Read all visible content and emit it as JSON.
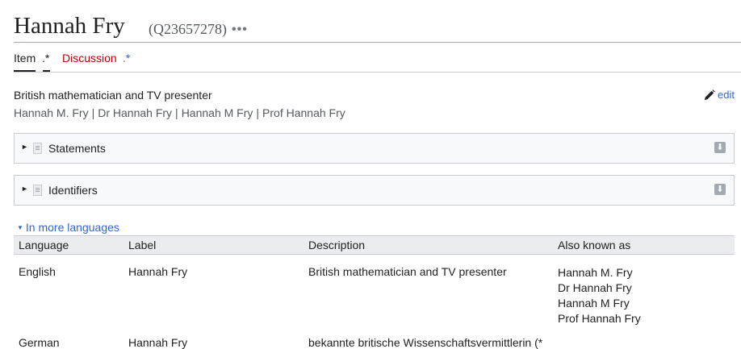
{
  "header": {
    "title": "Hannah Fry",
    "qid": "(Q23657278)",
    "more": "•••"
  },
  "tabs": [
    {
      "label": "Item",
      "suffix": ".*"
    },
    {
      "label": "Discussion",
      "suffix": ".*"
    }
  ],
  "entity": {
    "description": "British mathematician and TV presenter",
    "aliases": [
      "Hannah M. Fry",
      "Dr Hannah Fry",
      "Hannah M Fry",
      "Prof Hannah Fry"
    ],
    "alias_separator": "|",
    "edit_label": "edit"
  },
  "sections": [
    {
      "label": "Statements",
      "download_icon": "download-icon"
    },
    {
      "label": "Identifiers",
      "download_icon": "download-icon"
    }
  ],
  "languages": {
    "toggle_label": "In more languages",
    "columns": [
      "Language",
      "Label",
      "Description",
      "Also known as"
    ],
    "rows": [
      {
        "language": "English",
        "label": "Hannah Fry",
        "description": "British mathematician and TV presenter",
        "aliases": [
          "Hannah M. Fry",
          "Dr Hannah Fry",
          "Hannah M Fry",
          "Prof Hannah Fry"
        ]
      },
      {
        "language": "German",
        "label": "Hannah Fry",
        "description": "bekannte britische Wissenschaftsvermittlerin (*",
        "aliases": []
      }
    ]
  },
  "colors": {
    "link": "#3366cc",
    "discussion": "#ba0000",
    "text": "#202122",
    "muted": "#54595d"
  }
}
